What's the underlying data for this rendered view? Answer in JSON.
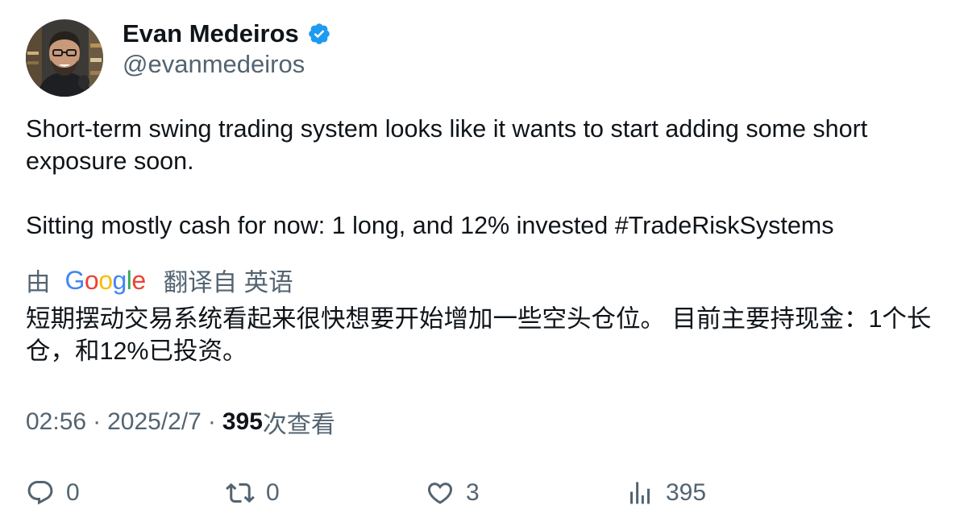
{
  "author": {
    "display_name": "Evan Medeiros",
    "handle": "@evanmedeiros",
    "verified": true,
    "verified_color": "#1d9bf0",
    "avatar_icon": "profile-photo"
  },
  "tweet": {
    "paragraphs": [
      "Short-term swing trading system looks like it wants to start adding some short exposure soon.",
      "Sitting mostly cash for now: 1 long, and 12% invested #TradeRiskSystems"
    ]
  },
  "translation": {
    "by_label": "由",
    "provider": "Google",
    "from_label": "翻译自 英语",
    "text": "短期摆动交易系统看起来很快想要开始增加一些空头仓位。 目前主要持现金：1个长仓，和12%已投资。"
  },
  "meta": {
    "time": "02:56",
    "separator": "·",
    "date": "2025/2/7",
    "views_count": "395",
    "views_label": "次查看"
  },
  "actions": {
    "reply": {
      "icon": "reply-icon",
      "count": "0"
    },
    "retweet": {
      "icon": "retweet-icon",
      "count": "0"
    },
    "like": {
      "icon": "heart-icon",
      "count": "3"
    },
    "views": {
      "icon": "views-icon",
      "count": "395"
    }
  },
  "colors": {
    "text_primary": "#0f1419",
    "text_secondary": "#536471",
    "accent": "#1d9bf0"
  }
}
